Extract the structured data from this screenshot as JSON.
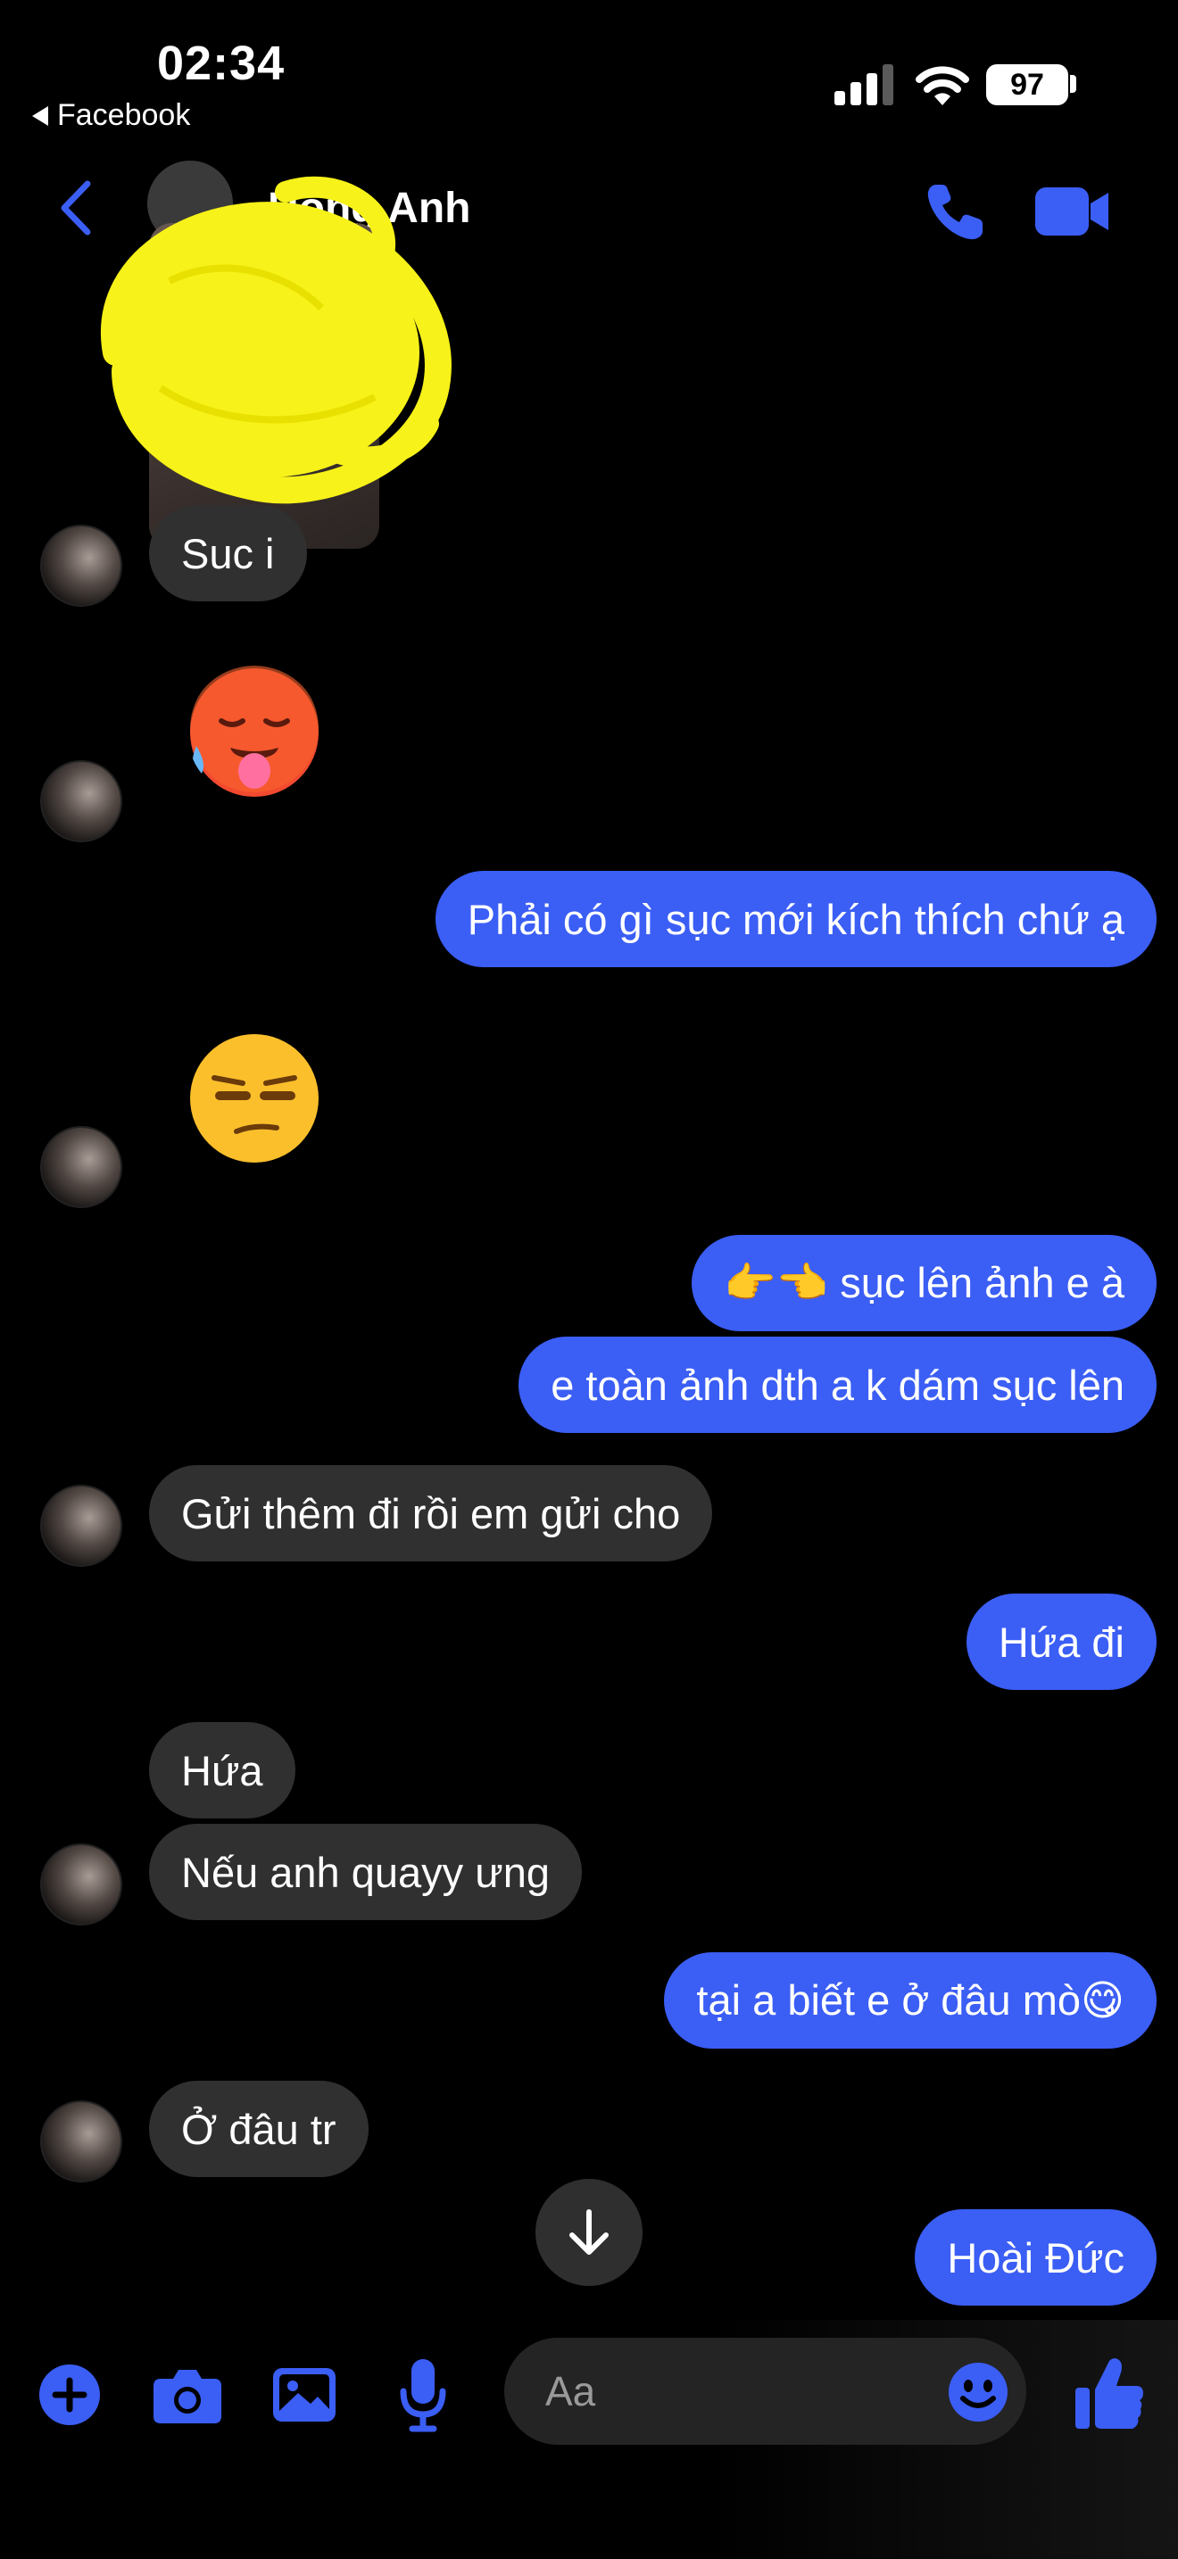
{
  "status_bar": {
    "time": "02:34",
    "back_app": "Facebook",
    "battery": "97"
  },
  "header": {
    "contact_name": "Hong  Anh"
  },
  "messages": [
    {
      "side": "received",
      "text": "Suc i"
    },
    {
      "side": "received",
      "emoji": "hot-face-icon"
    },
    {
      "side": "sent",
      "text": "Phải có gì sục mới kích thích chứ ạ"
    },
    {
      "side": "received",
      "emoji": "unamused-face-icon"
    },
    {
      "side": "sent",
      "text": "👉👈 sục lên ảnh e à"
    },
    {
      "side": "sent",
      "text": "e toàn ảnh dth a k dám sục lên"
    },
    {
      "side": "received",
      "text": "Gửi thêm đi rồi em gửi cho"
    },
    {
      "side": "sent",
      "text": "Hứa đi"
    },
    {
      "side": "received",
      "text": "Hứa"
    },
    {
      "side": "received",
      "text": "Nếu anh quayy ưng"
    },
    {
      "side": "sent",
      "text": "tại a biết e ở đâu mò😋"
    },
    {
      "side": "received",
      "text": "Ở đâu tr"
    },
    {
      "side": "sent",
      "text": "Hoài Đức"
    }
  ],
  "composer": {
    "placeholder": "Aa"
  },
  "colors": {
    "accent": "#3b5ef5",
    "received_bubble": "#303030",
    "background": "#000000",
    "scribble": "#f7f219"
  }
}
